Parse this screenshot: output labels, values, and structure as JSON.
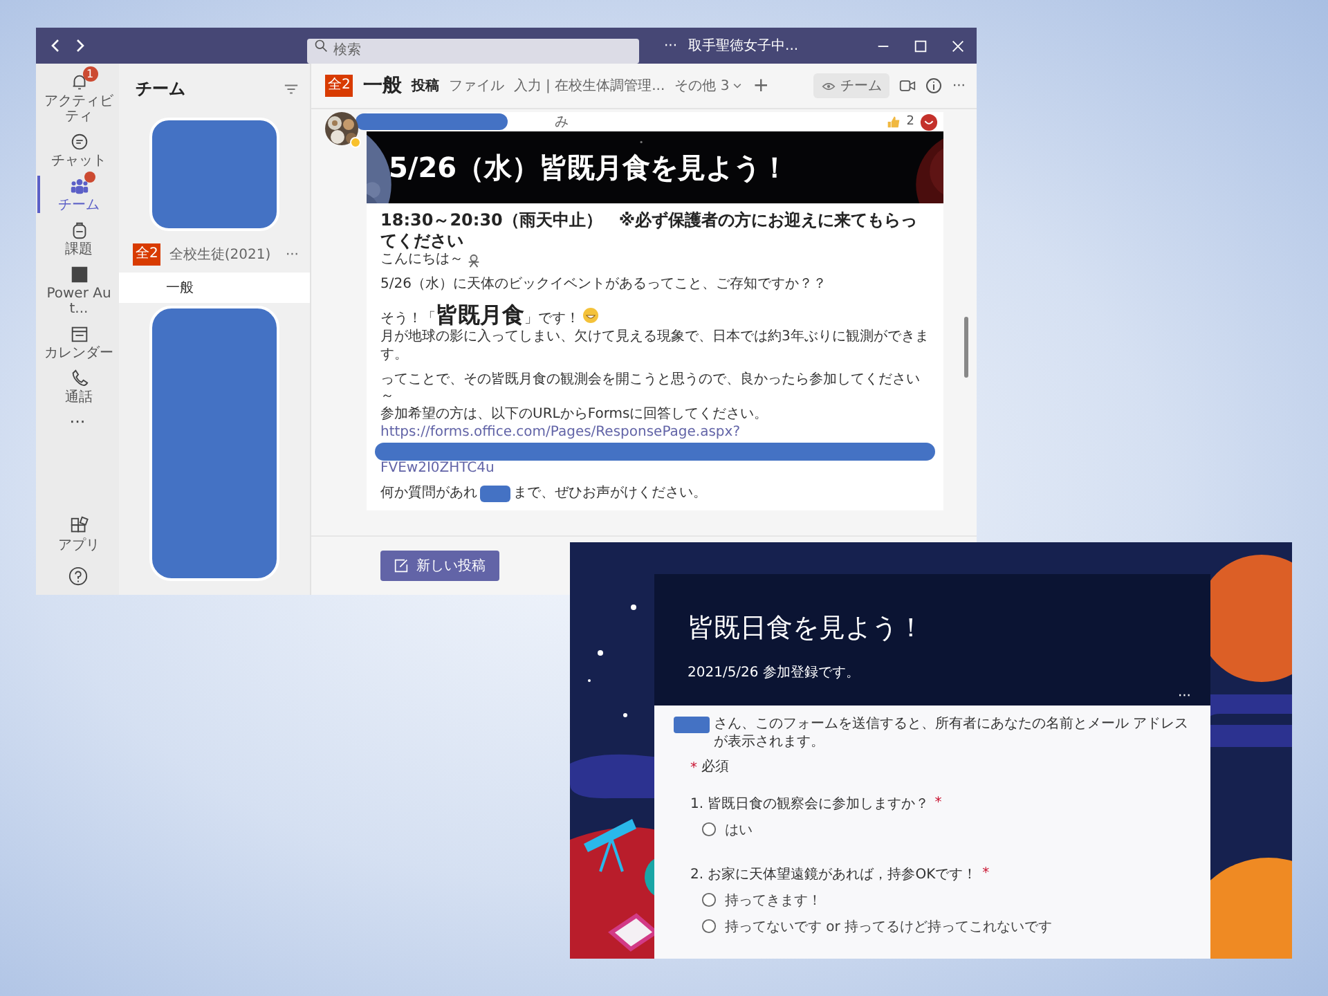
{
  "teams_window": {
    "title_bar": {
      "search_placeholder": "検索",
      "more": "···",
      "org_name": "取手聖徳女子中..."
    },
    "rail": [
      {
        "label": "アクティビティ",
        "badge": "1",
        "dot": false,
        "selected": false
      },
      {
        "label": "チャット",
        "dot": false,
        "selected": false
      },
      {
        "label": "チーム",
        "dot": true,
        "selected": true
      },
      {
        "label": "課題",
        "dot": false,
        "selected": false
      },
      {
        "label": "Power Aut...",
        "dot": false,
        "selected": false
      },
      {
        "label": "カレンダー",
        "dot": false,
        "selected": false
      },
      {
        "label": "通話",
        "dot": false,
        "selected": false
      }
    ],
    "rail_more": "···",
    "rail_bottom": [
      {
        "label": "アプリ"
      }
    ],
    "teams_panel": {
      "title": "チーム",
      "team": {
        "tile": "全2",
        "name": "全校生徒(2021)",
        "more": "···",
        "channels": [
          {
            "name": "一般",
            "selected": true
          }
        ]
      }
    },
    "channel_header": {
      "tile": "全2",
      "name": "一般",
      "tabs": [
        {
          "label": "投稿",
          "selected": true
        },
        {
          "label": "ファイル",
          "selected": false
        },
        {
          "label": "入力 | 在校生体調管理...",
          "selected": false
        },
        {
          "label": "その他 3",
          "selected": false
        }
      ],
      "add": "+",
      "team_button": "チーム",
      "more": "···"
    },
    "post": {
      "author_suffix": "み",
      "likes": "2",
      "banner_title": "5/26（水）皆既月食を見よう！",
      "heading": "18:30～20:30（雨天中止）　※必ず保護者の方にお迎えに来てもらってください",
      "paragraphs": [
        [
          {
            "kind": "greeting",
            "text": "こんにちは～"
          }
        ],
        [
          {
            "kind": "text",
            "text": "5/26（水）に天体のビックイベントがあるってこと、ご存知ですか？？"
          }
        ],
        [
          {
            "kind": "emphasis",
            "before": "そう！「",
            "big": "皆既月食",
            "after": "」です！"
          },
          {
            "kind": "text",
            "text": "月が地球の影に入ってしまい、欠けて見える現象で、日本では約3年ぶりに観測ができます。"
          }
        ],
        [
          {
            "kind": "text",
            "text": "ってことで、その皆既月食の観測会を開こうと思うので、良かったら参加してください～"
          },
          {
            "kind": "text",
            "text": "参加希望の方は、以下のURLからFormsに回答してください。"
          },
          {
            "kind": "link",
            "text": "https://forms.office.com/Pages/ResponsePage.aspx?"
          },
          {
            "kind": "redacted"
          },
          {
            "kind": "link",
            "text": "FVEw2I0ZHTC4u"
          }
        ],
        [
          {
            "kind": "redacted_inline",
            "before": "何か質問があれ",
            "after": "まで、ぜひお声がけください。"
          }
        ]
      ]
    },
    "new_post_button": "新しい投稿"
  },
  "form_window": {
    "title": "皆既日食を見よう！",
    "subtitle": "2021/5/26 参加登録です。",
    "more": "···",
    "notice": "さん、このフォームを送信すると、所有者にあなたの名前とメール アドレスが表示されます。",
    "required_note": {
      "mark": "*",
      "text": "必須"
    },
    "questions": [
      {
        "number": "1.",
        "text": "皆既日食の観察会に参加しますか？",
        "mark": "*",
        "options": [
          {
            "label": "はい",
            "selected": false
          }
        ]
      },
      {
        "number": "2.",
        "text": "お家に天体望遠鏡があれば，持参OKです！",
        "mark": "*",
        "options": [
          {
            "label": "持ってきます！",
            "selected": false
          },
          {
            "label": "持ってないです or 持ってるけど持ってこれないです",
            "selected": false
          }
        ]
      }
    ]
  }
}
